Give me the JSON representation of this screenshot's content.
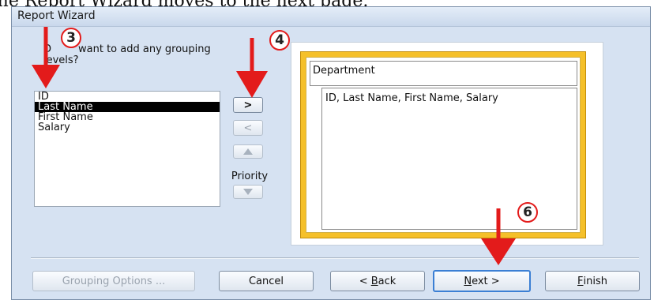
{
  "caption": "The Report Wizard moves to the next page.",
  "window": {
    "title": "Report Wizard"
  },
  "prompt": {
    "part_visible_start": "D",
    "part_visible_end": "want to add any grouping",
    "line2": "levels?"
  },
  "fields": {
    "items": [
      {
        "label": "ID",
        "selected": false
      },
      {
        "label": "Last Name",
        "selected": true
      },
      {
        "label": "First Name",
        "selected": false
      },
      {
        "label": "Salary",
        "selected": false
      }
    ]
  },
  "mover_buttons": {
    "add": ">",
    "remove": "<",
    "priority_label": "Priority"
  },
  "preview": {
    "group_header": "Department",
    "detail_fields": "ID, Last Name, First Name, Salary"
  },
  "footer": {
    "grouping_options": "Grouping Options ...",
    "cancel": "Cancel",
    "back_prefix": "< ",
    "back_mnemonic": "B",
    "back_rest": "ack",
    "next_mnemonic": "N",
    "next_rest": "ext >",
    "finish_mnemonic": "F",
    "finish_rest": "inish"
  },
  "callouts": {
    "step3": "3",
    "step4": "4",
    "step6": "6"
  },
  "colors": {
    "arrow": "#e31b1b",
    "preview_accent": "#f5c02a",
    "dialog_bg": "#d6e2f2"
  }
}
